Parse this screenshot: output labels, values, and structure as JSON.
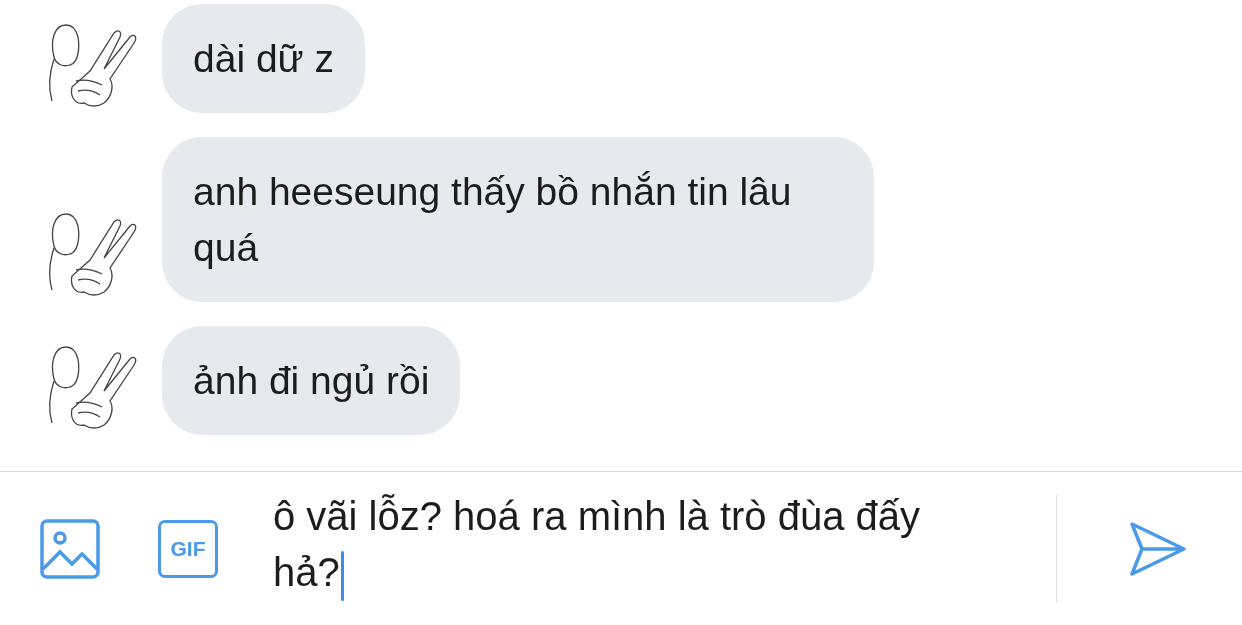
{
  "messages": [
    {
      "text": "dài dữ z"
    },
    {
      "text": "anh heeseung thấy bồ nhắn tin lâu quá"
    },
    {
      "text": "ảnh đi ngủ rồi"
    }
  ],
  "composer": {
    "value": "ô vãi lỗz? hoá ra mình là trò đùa đấy hả?",
    "gif_label": "GIF"
  }
}
